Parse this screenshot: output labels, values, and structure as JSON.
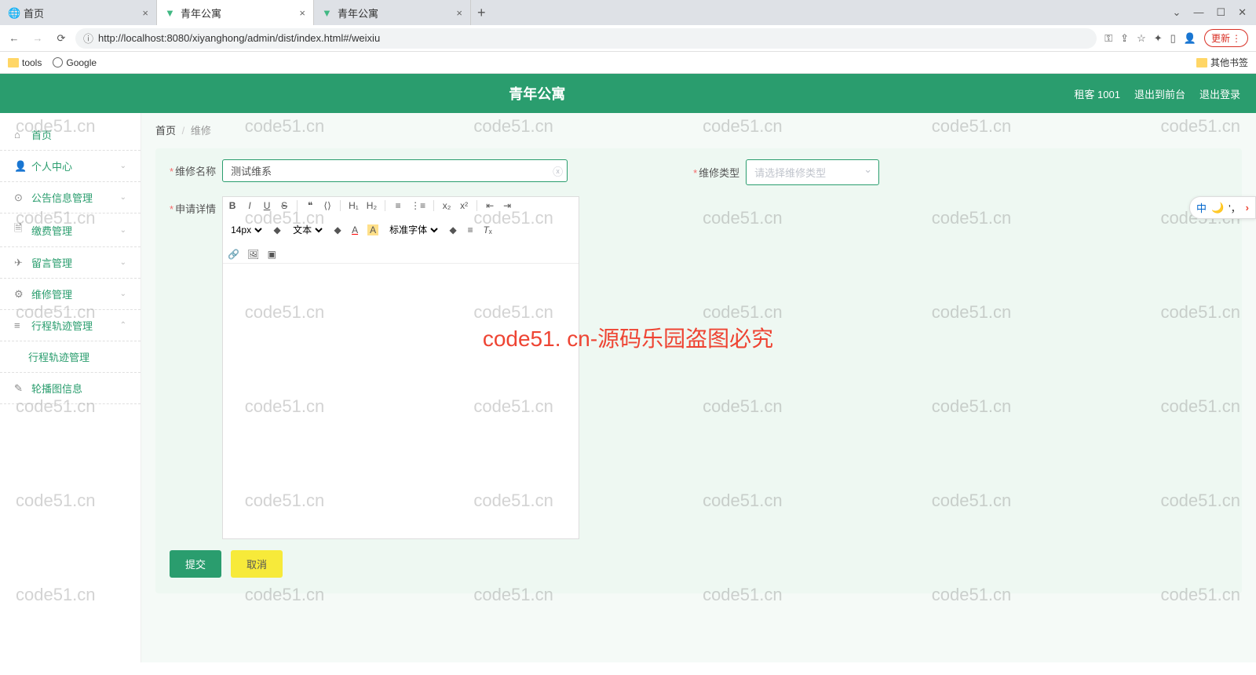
{
  "browser": {
    "tabs": [
      {
        "title": "首页",
        "active": false
      },
      {
        "title": "青年公寓",
        "active": true
      },
      {
        "title": "青年公寓",
        "active": false
      }
    ],
    "url": "http://localhost:8080/xiyanghong/admin/dist/index.html#/weixiu",
    "update_label": "更新",
    "bookmarks": {
      "tools": "tools",
      "google": "Google",
      "other": "其他书签"
    }
  },
  "header": {
    "title": "青年公寓",
    "user": "租客 1001",
    "to_front": "退出到前台",
    "logout": "退出登录"
  },
  "sidebar": {
    "home": "首页",
    "personal": "个人中心",
    "notice": "公告信息管理",
    "fee": "缴费管理",
    "message": "留言管理",
    "repair": "维修管理",
    "track": "行程轨迹管理",
    "track_sub": "行程轨迹管理",
    "carousel": "轮播图信息"
  },
  "breadcrumb": {
    "home": "首页",
    "current": "维修"
  },
  "form": {
    "name_label": "维修名称",
    "name_value": "测试维系",
    "type_label": "维修类型",
    "type_placeholder": "请选择维修类型",
    "detail_label": "申请详情",
    "submit": "提交",
    "cancel": "取消"
  },
  "editor_toolbar": {
    "fontsize": "14px",
    "style": "文本",
    "fontfamily": "标准字体"
  },
  "watermark": "code51.cn",
  "watermark_red": "code51. cn-源码乐园盗图必究",
  "float": {
    "lang": "中",
    "comma": "'，"
  }
}
